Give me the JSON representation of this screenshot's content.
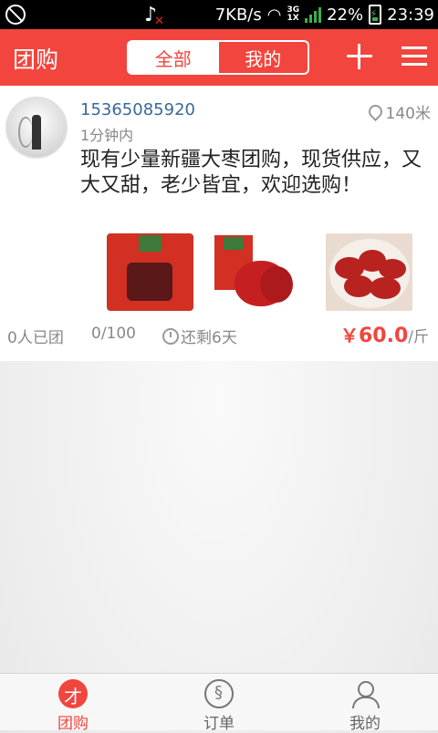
{
  "status_bar": {
    "speed": "7KB/s",
    "network_top": "3G",
    "network_bottom": "1X",
    "battery": "22%",
    "time": "23:39"
  },
  "header": {
    "title": "团购",
    "tabs": [
      {
        "label": "全部",
        "active": true
      },
      {
        "label": "我的",
        "active": false
      }
    ]
  },
  "post": {
    "user": "15365085920",
    "posted": "1分钟内",
    "distance": "140米",
    "description": "现有少量新疆大枣团购，现货供应，又大又甜，老少皆宜，欢迎选购！",
    "photos": [
      "jujube-bag-photo",
      "jujube-bag-with-dates-photo",
      "jujube-plate-photo"
    ],
    "joined": "0人已团",
    "progress": "0/100",
    "remaining": "还剩6天",
    "price_symbol": "￥",
    "price": "60.0",
    "unit": "/斤"
  },
  "bottom_nav": [
    {
      "label": "团购",
      "icon": "group-buy-icon",
      "active": true
    },
    {
      "label": "订单",
      "icon": "orders-icon",
      "active": false
    },
    {
      "label": "我的",
      "icon": "profile-icon",
      "active": false
    }
  ],
  "colors": {
    "accent": "#f2453d",
    "link": "#3a6898"
  }
}
